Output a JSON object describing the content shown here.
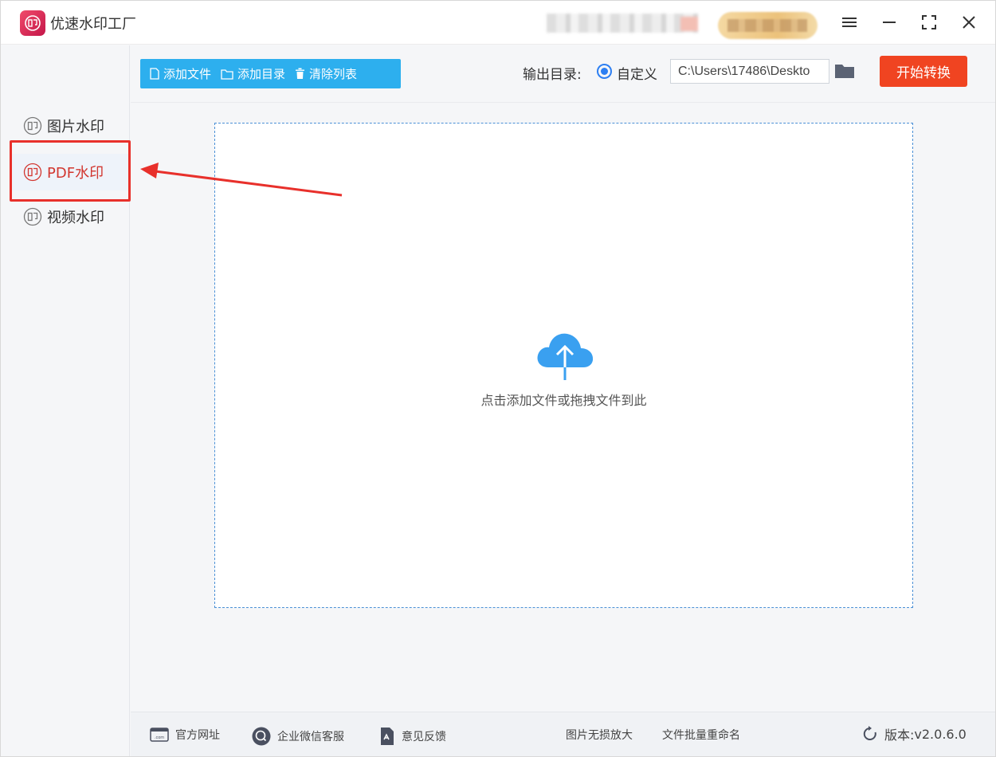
{
  "app": {
    "title": "优速水印工厂",
    "logo_icon": "stamp-logo-icon",
    "brand_color": "#d2362f"
  },
  "sidebar": {
    "items": [
      {
        "label": "图片水印",
        "icon": "stamp-icon",
        "active": false
      },
      {
        "label": "PDF水印",
        "icon": "stamp-icon",
        "active": true
      },
      {
        "label": "视频水印",
        "icon": "stamp-icon",
        "active": false
      }
    ]
  },
  "toolbar": {
    "add_file": "添加文件",
    "add_folder": "添加目录",
    "clear_list": "清除列表",
    "output_label": "输出目录:",
    "custom_option": "自定义",
    "output_path": "C:\\Users\\17486\\Deskto",
    "start_button": "开始转换",
    "accent_color": "#2dafee",
    "start_color": "#f04421"
  },
  "dropzone": {
    "hint": "点击添加文件或拖拽文件到此",
    "icon": "cloud-upload-icon"
  },
  "footer": {
    "website": "官方网址",
    "wechat_service": "企业微信客服",
    "feedback": "意见反馈",
    "lossless_upscale": "图片无损放大",
    "batch_rename": "文件批量重命名",
    "version_label": "版本:",
    "version_value": "v2.0.6.0"
  }
}
